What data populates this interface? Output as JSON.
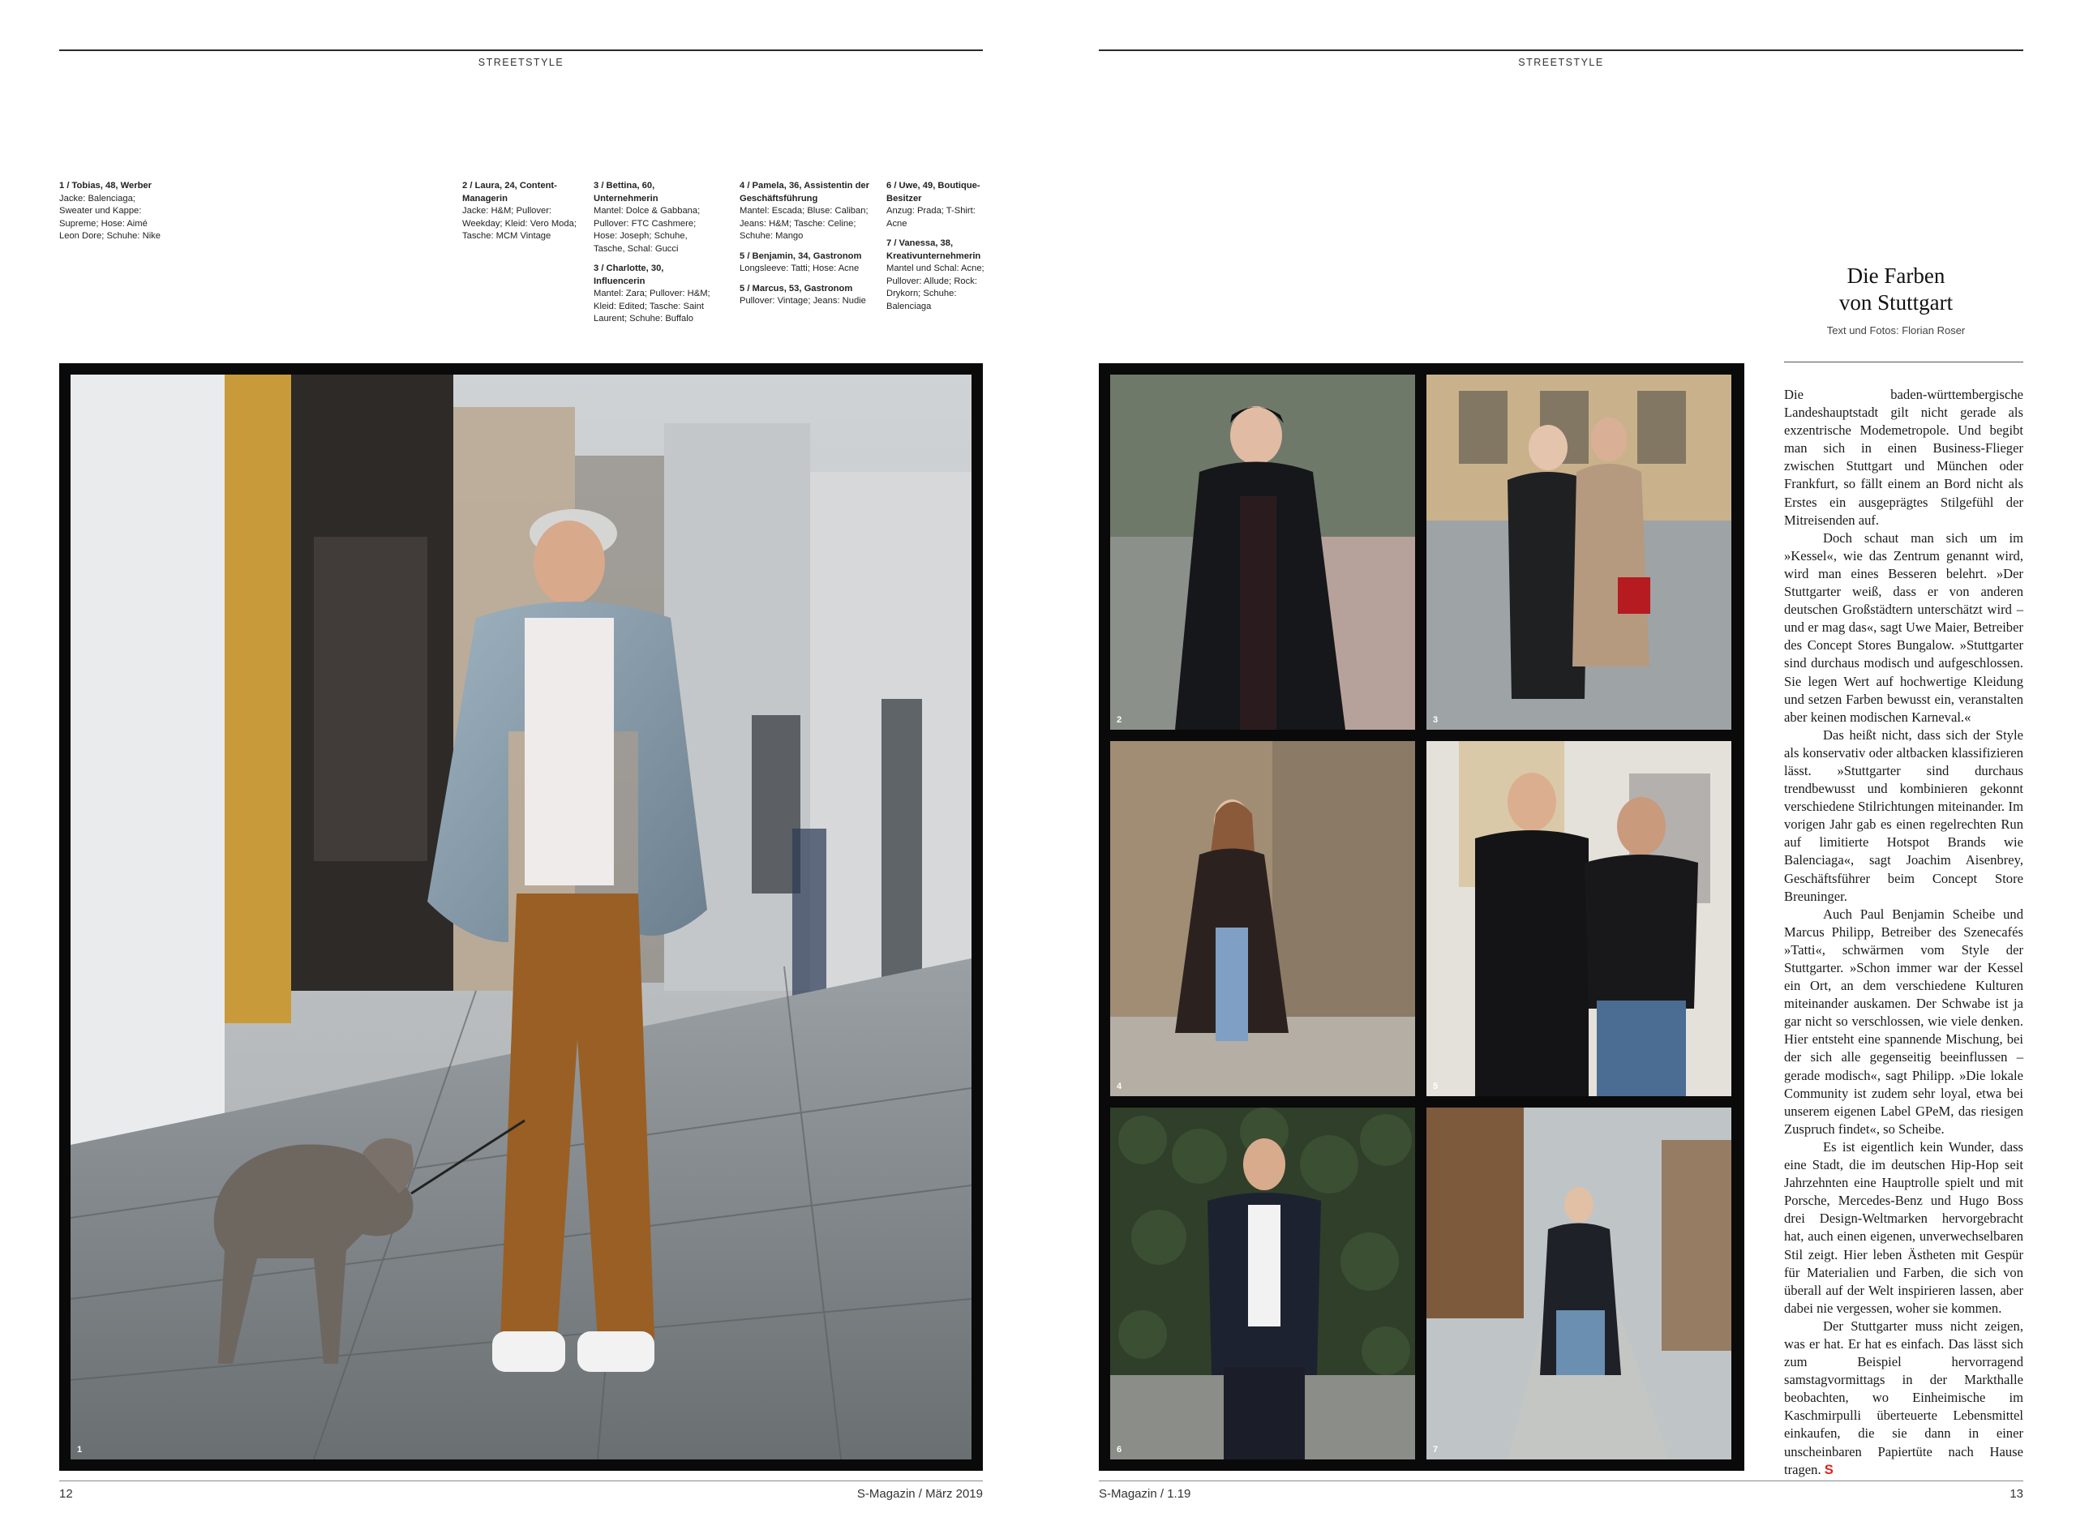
{
  "left_page": {
    "section_label": "STREETSTYLE",
    "page_number": "12",
    "footer_title": "S-Magazin / März 2019",
    "credits": [
      {
        "name": "1 / Tobias, 48, Werber",
        "desc": "Jacke: Balenciaga; Sweater und Kappe: Supreme; Hose: Aimé Leon Dore; Schuhe: Nike"
      },
      {
        "name": "2 / Laura, 24, Content-Managerin",
        "desc": "Jacke: H&M; Pullover: Weekday; Kleid: Vero Moda; Tasche: MCM Vintage"
      },
      {
        "name": "3 / Bettina, 60, Unternehmerin",
        "desc": "Mantel: Dolce & Gabbana; Pullover: FTC Cashmere; Hose: Joseph; Schuhe, Tasche, Schal: Gucci"
      },
      {
        "name": "3 / Charlotte, 30, Influencerin",
        "desc": "Mantel: Zara; Pullover: H&M; Kleid: Edited; Tasche: Saint Laurent; Schuhe: Buffalo"
      },
      {
        "name": "4 / Pamela, 36, Assistentin der Geschäftsführung",
        "desc": "Mantel: Escada; Bluse: Caliban; Jeans: H&M; Tasche: Celine; Schuhe: Mango"
      },
      {
        "name": "5 / Benjamin, 34, Gastronom",
        "desc": "Longsleeve: Tatti; Hose: Acne"
      },
      {
        "name": "5 / Marcus, 53, Gastronom",
        "desc": "Pullover: Vintage; Jeans: Nudie"
      },
      {
        "name": "6 / Uwe, 49, Boutique-Besitzer",
        "desc": "Anzug: Prada; T-Shirt: Acne"
      },
      {
        "name": "7 / Vanessa, 38, Kreativunternehmerin",
        "desc": "Mantel und Schal: Acne; Pullover: Allude; Rock: Drykorn; Schuhe: Balenciaga"
      }
    ],
    "main_photo_number": "1"
  },
  "right_page": {
    "section_label": "STREETSTYLE",
    "page_number": "13",
    "footer_title": "S-Magazin / 1.19",
    "title_line1": "Die Farben",
    "title_line2": "von Stuttgart",
    "byline": "Text und Fotos: Florian Roser",
    "photo_numbers": [
      "2",
      "3",
      "4",
      "5",
      "6",
      "7"
    ],
    "paragraphs": [
      "Die baden-württembergische Landeshauptstadt gilt nicht gerade als exzentrische Modemetropole. Und begibt man sich in einen Business-Flieger zwischen Stuttgart und München oder Frankfurt, so fällt einem an Bord nicht als Erstes ein ausgeprägtes Stilgefühl der Mitreisenden auf.",
      "Doch schaut man sich um im »Kessel«, wie das Zentrum genannt wird, wird man eines Besseren belehrt. »Der Stuttgarter weiß, dass er von anderen deutschen Großstädtern unterschätzt wird – und er mag das«, sagt Uwe Maier, Betreiber des Concept Stores Bungalow. »Stuttgarter sind durchaus modisch und aufgeschlossen. Sie legen Wert auf hochwertige Kleidung und setzen Farben bewusst ein, veranstalten aber keinen modischen Karneval.«",
      "Das heißt nicht, dass sich der Style als konservativ oder altbacken klassifizieren lässt. »Stuttgarter sind durchaus trendbewusst und kombinieren gekonnt verschiedene Stilrichtungen miteinander. Im vorigen Jahr gab es einen regelrechten Run auf limitierte Hotspot Brands wie Balenciaga«, sagt Joachim Aisenbrey, Geschäftsführer beim Concept Store Breuninger.",
      "Auch Paul Benjamin Scheibe und Marcus Philipp, Betreiber des Szenecafés »Tatti«, schwärmen vom Style der Stuttgarter. »Schon immer war der Kessel ein Ort, an dem verschiedene Kulturen miteinander auskamen. Der Schwabe ist ja gar nicht so verschlossen, wie viele denken. Hier entsteht eine spannende Mischung, bei der sich alle gegenseitig beeinflussen – gerade modisch«, sagt Philipp. »Die lokale Community ist zudem sehr loyal, etwa bei unserem eigenen Label GPeM, das riesigen Zuspruch findet«, so Scheibe.",
      "Es ist eigentlich kein Wunder, dass eine Stadt, die im deutschen Hip-Hop seit Jahrzehnten eine Hauptrolle spielt und mit Porsche, Mercedes-Benz und Hugo Boss drei Design-Weltmarken hervorgebracht hat, auch einen eigenen, unverwechselbaren Stil zeigt. Hier leben Ästheten mit Gespür für Materialien und Farben, die sich von überall auf der Welt inspirieren lassen, aber dabei nie vergessen, woher sie kommen.",
      "Der Stuttgarter muss nicht zeigen, was er hat. Er hat es einfach. Das lässt sich zum Beispiel hervorragend samstagvormittags in der Markthalle beobachten, wo Einheimische im Kaschmirpulli überteuerte Lebensmittel einkaufen, die sie dann in einer unscheinbaren Papiertüte nach Hause tragen."
    ],
    "end_mark": "S"
  }
}
